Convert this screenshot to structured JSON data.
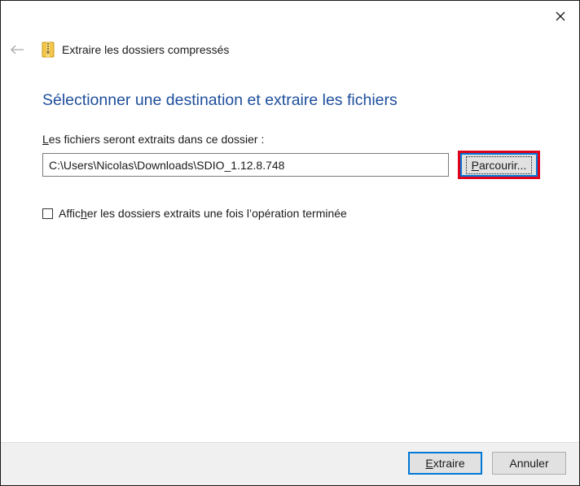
{
  "window": {
    "title": "Extraire les dossiers compressés"
  },
  "heading": "Sélectionner une destination et extraire les fichiers",
  "destination": {
    "label_accel": "L",
    "label_rest": "es fichiers seront extraits dans ce dossier :",
    "path_value": "C:\\Users\\Nicolas\\Downloads\\SDIO_1.12.8.748"
  },
  "browse_button": {
    "accel": "P",
    "rest": "arcourir..."
  },
  "show_folders_checkbox": {
    "label_before": "Affic",
    "label_accel": "h",
    "label_after": "er les dossiers extraits une fois l’opération terminée",
    "checked": false
  },
  "footer": {
    "extract_accel": "E",
    "extract_rest": "xtraire",
    "cancel_label": "Annuler"
  },
  "colors": {
    "heading": "#1e4e9c",
    "highlight": "#e0001b",
    "focus": "#0078d7",
    "footer_bg": "#f0f0f0"
  },
  "icons": {
    "close": "close-icon",
    "back": "back-arrow-icon",
    "zip": "zip-folder-icon"
  }
}
